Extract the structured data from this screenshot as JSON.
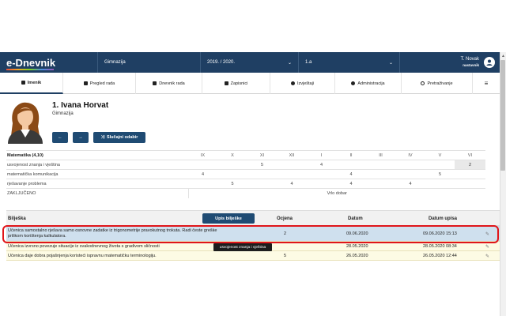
{
  "app": {
    "title": "e-Dnevnik"
  },
  "topbar": {
    "school_select": "Gimnazija",
    "year_select": "2019. / 2020.",
    "class_select": "1.a",
    "user_name": "T. Novak",
    "user_role": "nastavnik"
  },
  "nav": {
    "items": [
      {
        "label": "Imenik",
        "active": true,
        "icon": "book-icon"
      },
      {
        "label": "Pregled rada",
        "active": false,
        "icon": "document-icon"
      },
      {
        "label": "Dnevnik rada",
        "active": false,
        "icon": "notebook-icon"
      },
      {
        "label": "Zapisnici",
        "active": false,
        "icon": "briefcase-icon"
      },
      {
        "label": "Izvještaji",
        "active": false,
        "icon": "pie-chart-icon"
      },
      {
        "label": "Administracija",
        "active": false,
        "icon": "gear-icon"
      },
      {
        "label": "Pretraživanje",
        "active": false,
        "icon": "search-icon"
      }
    ],
    "menu_icon": "hamburger-icon"
  },
  "student": {
    "name": "1. Ivana Horvat",
    "school": "Gimnazija"
  },
  "buttons": {
    "prev": "←",
    "next": "→",
    "random": "Slučajni odabir"
  },
  "grades": {
    "subject": "Matematika (4,10)",
    "months": [
      "IX",
      "X",
      "XI",
      "XII",
      "I",
      "II",
      "III",
      "IV",
      "V",
      "VI"
    ],
    "rows": [
      {
        "label": "usvojenost znanja i vještina",
        "values": [
          "",
          "",
          "5",
          "",
          "4",
          "",
          "",
          "",
          "",
          "2"
        ]
      },
      {
        "label": "matematička komunikacija",
        "values": [
          "4",
          "",
          "",
          "",
          "",
          "4",
          "",
          "",
          "5",
          ""
        ]
      },
      {
        "label": "rješavanje problema",
        "values": [
          "",
          "5",
          "",
          "4",
          "",
          "4",
          "",
          "4",
          "",
          ""
        ]
      }
    ],
    "final_label": "ZAKLJUČENO",
    "final_value": "Vrlo dobar"
  },
  "notes": {
    "headers": {
      "note": "Bilješka",
      "add_button": "Upis bilješke",
      "grade": "Ocjena",
      "date": "Datum",
      "entry_date": "Datum upisa"
    },
    "rows": [
      {
        "text": "Učenica samostalno rješava samo osnovne zadatke iz trigonometrije pravokutnog trokuta. Radi česte greške prilikom korištenja kalkulatora.",
        "grade": "2",
        "date": "09.06.2020",
        "entry_date": "09.06.2020 15:13"
      },
      {
        "text": "Učenica izvrsno povezuje situacije iz svakodnevnog života s gradivom sličnosti",
        "grade": "",
        "date": "28.05.2020",
        "entry_date": "28.05.2020 08:34"
      },
      {
        "text": "Učenica daje dobra pojašnjenja koristeći ispravnu matematičku terminologiju.",
        "grade": "5",
        "date": "26.05.2020",
        "entry_date": "26.05.2020 12:44"
      }
    ],
    "tooltip": "usvojenost znanja i vještina"
  },
  "colors": {
    "topbar": "#1f3f63",
    "button": "#1f4b73",
    "highlight": "#e0151a",
    "selected_row": "#cfe0ee",
    "note_row": "#fdfbe4"
  }
}
